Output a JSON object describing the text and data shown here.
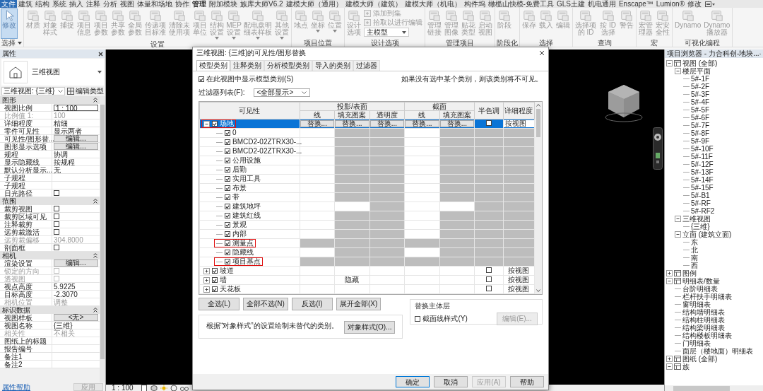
{
  "ribbon": {
    "tabs": [
      {
        "label": "文件",
        "kind": "file",
        "selected": false
      },
      {
        "label": "建筑",
        "kind": "tab",
        "selected": false
      },
      {
        "label": "结构",
        "kind": "tab",
        "selected": false
      },
      {
        "label": "系统",
        "kind": "tab",
        "selected": false
      },
      {
        "label": "插入",
        "kind": "tab",
        "selected": false
      },
      {
        "label": "注释",
        "kind": "tab",
        "selected": false
      },
      {
        "label": "分析",
        "kind": "tab",
        "selected": false
      },
      {
        "label": "视图",
        "kind": "tab",
        "selected": false
      },
      {
        "label": "体量和场地",
        "kind": "tab",
        "selected": false
      },
      {
        "label": "协作",
        "kind": "tab",
        "selected": false
      },
      {
        "label": "管理",
        "kind": "tab",
        "selected": true
      },
      {
        "label": "附加模块",
        "kind": "tab",
        "selected": false
      },
      {
        "label": "族库大师V6.2",
        "kind": "tab",
        "selected": false
      },
      {
        "label": "建模大师（通用）",
        "kind": "tab",
        "selected": false
      },
      {
        "label": "建模大师（建筑）",
        "kind": "tab",
        "selected": false
      },
      {
        "label": "建模大师（机电）",
        "kind": "tab",
        "selected": false
      },
      {
        "label": "构件坞",
        "kind": "tab",
        "selected": false
      },
      {
        "label": "橄榄山快模-免费工具",
        "kind": "tab",
        "selected": false
      },
      {
        "label": "GLS土建",
        "kind": "tab",
        "selected": false
      },
      {
        "label": "机电通用",
        "kind": "tab",
        "selected": false
      },
      {
        "label": "Enscape™",
        "kind": "tab",
        "selected": false
      },
      {
        "label": "Lumion®",
        "kind": "tab",
        "selected": false
      },
      {
        "label": "修改",
        "kind": "tab",
        "selected": false
      }
    ],
    "panels": [
      {
        "title": "选择",
        "menu": true,
        "items": [
          {
            "kind": "large",
            "label": "修改",
            "selected": true,
            "menu": false
          }
        ]
      },
      {
        "title": "设置",
        "menu": false,
        "items": [
          {
            "kind": "large",
            "label": "材质",
            "selected": false,
            "menu": false
          },
          {
            "kind": "large",
            "label": "对象样式",
            "selected": false,
            "menu": false
          },
          {
            "kind": "large",
            "label": "捕捉",
            "selected": false,
            "menu": false
          },
          {
            "kind": "large",
            "label": "项目信息",
            "selected": false,
            "menu": false
          },
          {
            "kind": "large",
            "label": "项目参数",
            "selected": false,
            "menu": false
          },
          {
            "kind": "large",
            "label": "共享参数",
            "selected": false,
            "menu": false
          },
          {
            "kind": "large",
            "label": "全局参数",
            "selected": false,
            "menu": false
          },
          {
            "kind": "large",
            "label": "传递项目标准",
            "selected": false,
            "menu": false
          },
          {
            "kind": "large",
            "label": "清除未使用项",
            "selected": false,
            "menu": false
          },
          {
            "kind": "large",
            "label": "项目单位",
            "selected": false,
            "menu": false
          },
          {
            "kind": "large",
            "label": "结构设置",
            "selected": false,
            "menu": true
          },
          {
            "kind": "large",
            "label": "MEP设置",
            "selected": false,
            "menu": true
          },
          {
            "kind": "large",
            "label": "配电盘明细表样板",
            "selected": false,
            "menu": true
          },
          {
            "kind": "large",
            "label": "其他设置",
            "selected": false,
            "menu": true
          }
        ]
      },
      {
        "title": "项目位置",
        "menu": false,
        "items": [
          {
            "kind": "large",
            "label": "地点",
            "selected": false,
            "menu": false
          },
          {
            "kind": "large",
            "label": "坐标",
            "selected": false,
            "menu": true
          },
          {
            "kind": "large",
            "label": "位置",
            "selected": false,
            "menu": true
          }
        ]
      },
      {
        "title": "设计选项",
        "menu": false,
        "items": [
          {
            "kind": "large",
            "label": "设计选项",
            "selected": false,
            "menu": false
          },
          {
            "kind": "small",
            "label": "添加到集",
            "selected": false,
            "menu": false
          },
          {
            "kind": "small",
            "label": "拾取以进行编辑",
            "selected": false,
            "menu": false
          },
          {
            "kind": "select",
            "label": "主模型",
            "selected": false,
            "menu": true
          }
        ]
      },
      {
        "title": "管理项目",
        "menu": false,
        "items": [
          {
            "kind": "large",
            "label": "管理链接",
            "selected": false,
            "menu": false
          },
          {
            "kind": "large",
            "label": "管理图像",
            "selected": false,
            "menu": false
          },
          {
            "kind": "large",
            "label": "贴花类型",
            "selected": false,
            "menu": false
          },
          {
            "kind": "large",
            "label": "启动视图",
            "selected": false,
            "menu": false
          }
        ]
      },
      {
        "title": "阶段化",
        "menu": false,
        "items": [
          {
            "kind": "large",
            "label": "阶段",
            "selected": false,
            "menu": false
          }
        ]
      },
      {
        "title": "选择",
        "menu": false,
        "items": [
          {
            "kind": "large",
            "label": "保存",
            "selected": false,
            "menu": false
          },
          {
            "kind": "large",
            "label": "载入",
            "selected": false,
            "menu": false
          },
          {
            "kind": "large",
            "label": "编辑",
            "selected": false,
            "menu": false
          }
        ]
      },
      {
        "title": "查询",
        "menu": false,
        "items": [
          {
            "kind": "large",
            "label": "选择项的 ID",
            "selected": false,
            "menu": false
          },
          {
            "kind": "large",
            "label": "按 ID选择",
            "selected": false,
            "menu": false
          },
          {
            "kind": "large",
            "label": "警告",
            "selected": false,
            "menu": false
          }
        ]
      },
      {
        "title": "宏",
        "menu": false,
        "items": [
          {
            "kind": "large",
            "label": "宏管理器",
            "selected": false,
            "menu": false
          },
          {
            "kind": "large",
            "label": "宏安全性",
            "selected": false,
            "menu": false
          }
        ]
      },
      {
        "title": "可视化编程",
        "menu": false,
        "items": [
          {
            "kind": "large",
            "label": "Dynamo",
            "selected": false,
            "menu": false
          },
          {
            "kind": "large",
            "label": "Dynamo播放器",
            "selected": false,
            "menu": false
          }
        ]
      }
    ]
  },
  "properties": {
    "title": "属性",
    "type_name": "三维视图",
    "type_selector": "三维视图: {三维}",
    "edit_type": "编辑类型",
    "groups": [
      {
        "title": "图形",
        "rows": [
          {
            "label": "视图比例",
            "kind": "input",
            "value": "1 : 100",
            "disabled": false
          },
          {
            "label": "比例值 1:",
            "kind": "text",
            "value": "100",
            "disabled": true
          },
          {
            "label": "详细程度",
            "kind": "text",
            "value": "精细",
            "disabled": false
          },
          {
            "label": "零件可见性",
            "kind": "text",
            "value": "显示两者",
            "disabled": false
          },
          {
            "label": "可见性/图形替...",
            "kind": "button",
            "value": "编辑...",
            "disabled": false
          },
          {
            "label": "图形显示选项",
            "kind": "button",
            "value": "编辑...",
            "disabled": false
          },
          {
            "label": "规程",
            "kind": "text",
            "value": "协调",
            "disabled": false
          },
          {
            "label": "显示隐藏线",
            "kind": "text",
            "value": "按规程",
            "disabled": false
          },
          {
            "label": "默认分析显示...",
            "kind": "text",
            "value": "无",
            "disabled": false
          },
          {
            "label": "子规程",
            "kind": "empty",
            "disabled": false
          },
          {
            "label": "子规程",
            "kind": "empty",
            "disabled": false
          },
          {
            "label": "日光路径",
            "kind": "checkbox",
            "checked": false,
            "disabled": false
          }
        ]
      },
      {
        "title": "范围",
        "rows": [
          {
            "label": "裁剪视图",
            "kind": "checkbox",
            "checked": false,
            "disabled": false
          },
          {
            "label": "裁剪区域可见",
            "kind": "checkbox",
            "checked": false,
            "disabled": false
          },
          {
            "label": "注释裁剪",
            "kind": "checkbox",
            "checked": false,
            "disabled": false
          },
          {
            "label": "远剪裁激活",
            "kind": "checkbox",
            "checked": false,
            "disabled": false
          },
          {
            "label": "远剪裁偏移",
            "kind": "text",
            "value": "304.8000",
            "disabled": true
          },
          {
            "label": "剖面框",
            "kind": "checkbox",
            "checked": false,
            "disabled": false
          }
        ]
      },
      {
        "title": "相机",
        "rows": [
          {
            "label": "渲染设置",
            "kind": "button",
            "value": "编辑...",
            "disabled": false
          },
          {
            "label": "锁定的方向",
            "kind": "checkbox",
            "checked": false,
            "disabled": true
          },
          {
            "label": "透视图",
            "kind": "checkbox",
            "checked": false,
            "disabled": true
          },
          {
            "label": "视点高度",
            "kind": "text",
            "value": "5.9225",
            "disabled": false
          },
          {
            "label": "目标高度",
            "kind": "text",
            "value": "-2.3070",
            "disabled": false
          },
          {
            "label": "相机位置",
            "kind": "text",
            "value": "调整",
            "disabled": true
          }
        ]
      },
      {
        "title": "标识数据",
        "rows": [
          {
            "label": "视图样板",
            "kind": "button",
            "value": "<无>",
            "disabled": false
          },
          {
            "label": "视图名称",
            "kind": "text",
            "value": "{三维}",
            "disabled": false
          },
          {
            "label": "相关性",
            "kind": "text",
            "value": "不相关",
            "disabled": true
          },
          {
            "label": "图纸上的标题",
            "kind": "empty",
            "disabled": false
          },
          {
            "label": "报告编号",
            "kind": "empty",
            "disabled": false
          },
          {
            "label": "备注1",
            "kind": "empty",
            "disabled": false
          },
          {
            "label": "备注2",
            "kind": "empty",
            "disabled": false
          }
        ]
      }
    ],
    "help_link": "属性帮助",
    "apply": "应用"
  },
  "status_bar": {
    "scale": "1 : 100"
  },
  "dialog": {
    "title": "三维视图: {三维}的可见性/图形替换",
    "tabs": [
      {
        "label": "模型类别",
        "selected": true
      },
      {
        "label": "注释类别",
        "selected": false
      },
      {
        "label": "分析模型类别",
        "selected": false
      },
      {
        "label": "导入的类别",
        "selected": false
      },
      {
        "label": "过滤器",
        "selected": false
      }
    ],
    "show_categories": {
      "label": "在此视图中显示模型类别(S)",
      "checked": true
    },
    "hint": "如果没有选中某个类别，则该类别将不可见。",
    "filter": {
      "label": "过滤器列表(F):",
      "value": "<全部显示>"
    },
    "table": {
      "visibility": "可见性",
      "projection": "投影/表面",
      "section": "截面",
      "halftone": "半色调",
      "detail": "详细程度",
      "projection_columns": [
        "线",
        "填充图案",
        "透明度"
      ],
      "section_columns": [
        "线",
        "填充图案"
      ],
      "rows": [
        {
          "name": "场地",
          "checked": true,
          "expanded": true,
          "selected": true,
          "marked": true,
          "cells": [
            {
              "kind": "button",
              "text": "替换..."
            },
            {
              "kind": "button",
              "text": "替换..."
            },
            {
              "kind": "button",
              "text": "替换..."
            },
            {
              "kind": "button",
              "text": "替换..."
            },
            {
              "kind": "button",
              "text": "替换..."
            },
            {
              "kind": "checkbox",
              "checked": false
            },
            {
              "kind": "field",
              "text": "按视图"
            }
          ],
          "children": [
            {
              "name": "0",
              "checked": true,
              "selected": false,
              "marked": false,
              "cells": [
                {
                  "kind": "blank"
                },
                {
                  "kind": "na"
                },
                {
                  "kind": "na"
                },
                {
                  "kind": "blank"
                },
                {
                  "kind": "na"
                },
                {
                  "kind": "na"
                },
                {
                  "kind": "na"
                }
              ]
            },
            {
              "name": "BMCD2-02ZTRX30-...",
              "checked": true,
              "selected": false,
              "marked": false,
              "cells": [
                {
                  "kind": "blank"
                },
                {
                  "kind": "na"
                },
                {
                  "kind": "na"
                },
                {
                  "kind": "blank"
                },
                {
                  "kind": "na"
                },
                {
                  "kind": "na"
                },
                {
                  "kind": "na"
                }
              ]
            },
            {
              "name": "BMCD2-02ZTRX30-...",
              "checked": true,
              "selected": false,
              "marked": false,
              "cells": [
                {
                  "kind": "blank"
                },
                {
                  "kind": "na"
                },
                {
                  "kind": "na"
                },
                {
                  "kind": "blank"
                },
                {
                  "kind": "na"
                },
                {
                  "kind": "na"
                },
                {
                  "kind": "na"
                }
              ]
            },
            {
              "name": "公用设施",
              "checked": true,
              "selected": false,
              "marked": false,
              "cells": [
                {
                  "kind": "blank"
                },
                {
                  "kind": "na"
                },
                {
                  "kind": "na"
                },
                {
                  "kind": "blank"
                },
                {
                  "kind": "na"
                },
                {
                  "kind": "na"
                },
                {
                  "kind": "na"
                }
              ]
            },
            {
              "name": "后勤",
              "checked": true,
              "selected": false,
              "marked": false,
              "cells": [
                {
                  "kind": "blank"
                },
                {
                  "kind": "na"
                },
                {
                  "kind": "na"
                },
                {
                  "kind": "blank"
                },
                {
                  "kind": "na"
                },
                {
                  "kind": "na"
                },
                {
                  "kind": "na"
                }
              ]
            },
            {
              "name": "实用工具",
              "checked": true,
              "selected": false,
              "marked": false,
              "cells": [
                {
                  "kind": "blank"
                },
                {
                  "kind": "na"
                },
                {
                  "kind": "na"
                },
                {
                  "kind": "blank"
                },
                {
                  "kind": "na"
                },
                {
                  "kind": "na"
                },
                {
                  "kind": "na"
                }
              ]
            },
            {
              "name": "布景",
              "checked": true,
              "selected": false,
              "marked": false,
              "cells": [
                {
                  "kind": "blank"
                },
                {
                  "kind": "na"
                },
                {
                  "kind": "na"
                },
                {
                  "kind": "blank"
                },
                {
                  "kind": "na"
                },
                {
                  "kind": "na"
                },
                {
                  "kind": "na"
                }
              ]
            },
            {
              "name": "带",
              "checked": true,
              "selected": false,
              "marked": false,
              "cells": [
                {
                  "kind": "blank"
                },
                {
                  "kind": "na"
                },
                {
                  "kind": "na"
                },
                {
                  "kind": "blank"
                },
                {
                  "kind": "na"
                },
                {
                  "kind": "na"
                },
                {
                  "kind": "na"
                }
              ]
            },
            {
              "name": "建筑地坪",
              "checked": true,
              "selected": false,
              "marked": false,
              "cells": [
                {
                  "kind": "blank"
                },
                {
                  "kind": "blank"
                },
                {
                  "kind": "na"
                },
                {
                  "kind": "blank"
                },
                {
                  "kind": "blank"
                },
                {
                  "kind": "na"
                },
                {
                  "kind": "na"
                }
              ]
            },
            {
              "name": "建筑红线",
              "checked": true,
              "selected": false,
              "marked": false,
              "cells": [
                {
                  "kind": "blank"
                },
                {
                  "kind": "na"
                },
                {
                  "kind": "na"
                },
                {
                  "kind": "blank"
                },
                {
                  "kind": "na"
                },
                {
                  "kind": "na"
                },
                {
                  "kind": "na"
                }
              ]
            },
            {
              "name": "景观",
              "checked": true,
              "selected": false,
              "marked": false,
              "cells": [
                {
                  "kind": "blank"
                },
                {
                  "kind": "na"
                },
                {
                  "kind": "na"
                },
                {
                  "kind": "blank"
                },
                {
                  "kind": "na"
                },
                {
                  "kind": "na"
                },
                {
                  "kind": "na"
                }
              ]
            },
            {
              "name": "内部",
              "checked": true,
              "selected": false,
              "marked": false,
              "cells": [
                {
                  "kind": "blank"
                },
                {
                  "kind": "na"
                },
                {
                  "kind": "na"
                },
                {
                  "kind": "blank"
                },
                {
                  "kind": "na"
                },
                {
                  "kind": "na"
                },
                {
                  "kind": "na"
                }
              ]
            },
            {
              "name": "测量点",
              "checked": true,
              "selected": false,
              "marked": true,
              "cells": [
                {
                  "kind": "na"
                },
                {
                  "kind": "na"
                },
                {
                  "kind": "na"
                },
                {
                  "kind": "na"
                },
                {
                  "kind": "na"
                },
                {
                  "kind": "na"
                },
                {
                  "kind": "na"
                }
              ]
            },
            {
              "name": "隐藏线",
              "checked": true,
              "selected": false,
              "marked": false,
              "cells": [
                {
                  "kind": "blank"
                },
                {
                  "kind": "na"
                },
                {
                  "kind": "na"
                },
                {
                  "kind": "blank"
                },
                {
                  "kind": "na"
                },
                {
                  "kind": "na"
                },
                {
                  "kind": "na"
                }
              ]
            },
            {
              "name": "项目基点",
              "checked": true,
              "selected": false,
              "marked": true,
              "cells": [
                {
                  "kind": "na"
                },
                {
                  "kind": "na"
                },
                {
                  "kind": "na"
                },
                {
                  "kind": "na"
                },
                {
                  "kind": "na"
                },
                {
                  "kind": "na"
                },
                {
                  "kind": "na"
                }
              ]
            }
          ]
        },
        {
          "name": "坡道",
          "checked": true,
          "expanded": false,
          "selected": false,
          "marked": false,
          "cells": [
            {
              "kind": "blank"
            },
            {
              "kind": "blank"
            },
            {
              "kind": "blank"
            },
            {
              "kind": "blank"
            },
            {
              "kind": "blank"
            },
            {
              "kind": "checkbox",
              "checked": false
            },
            {
              "kind": "text",
              "text": "按视图"
            }
          ]
        },
        {
          "name": "墙",
          "checked": true,
          "expanded": false,
          "selected": false,
          "marked": false,
          "cells": [
            {
              "kind": "blank"
            },
            {
              "kind": "text",
              "text": "隐藏"
            },
            {
              "kind": "blank"
            },
            {
              "kind": "blank"
            },
            {
              "kind": "blank"
            },
            {
              "kind": "checkbox",
              "checked": false
            },
            {
              "kind": "text",
              "text": "按视图"
            }
          ]
        },
        {
          "name": "天花板",
          "checked": true,
          "expanded": false,
          "selected": false,
          "marked": false,
          "cells": [
            {
              "kind": "blank"
            },
            {
              "kind": "blank"
            },
            {
              "kind": "blank"
            },
            {
              "kind": "blank"
            },
            {
              "kind": "blank"
            },
            {
              "kind": "checkbox",
              "checked": false
            },
            {
              "kind": "text",
              "text": "按视图"
            }
          ]
        }
      ]
    },
    "select_buttons": [
      "全选(L)",
      "全部不选(N)",
      "反选(I)",
      "展开全部(X)"
    ],
    "host_layers": {
      "title": "替换主体层",
      "label": "截面线样式(Y)",
      "checked": false,
      "edit": "编辑(E)...",
      "edit_disabled": true
    },
    "note": "根据“对象样式”的设置绘制未替代的类别。",
    "object_styles": "对象样式(O)...",
    "footer": [
      {
        "label": "确定",
        "default": true,
        "disabled": false
      },
      {
        "label": "取消",
        "default": false,
        "disabled": false
      },
      {
        "label": "应用(A)",
        "default": false,
        "disabled": true
      },
      {
        "label": "帮助",
        "default": false,
        "disabled": false
      }
    ]
  },
  "browser": {
    "title": "项目浏览器 - 力合科创-地块...",
    "tree": [
      {
        "label": "视图 (全部)",
        "expanded": true,
        "children": [
          {
            "label": "楼层平面",
            "expanded": true,
            "children": [
              {
                "label": "5#-1F"
              },
              {
                "label": "5#-2F"
              },
              {
                "label": "5#-3F"
              },
              {
                "label": "5#-4F"
              },
              {
                "label": "5#-5F"
              },
              {
                "label": "5#-6F"
              },
              {
                "label": "5#-7F"
              },
              {
                "label": "5#-8F"
              },
              {
                "label": "5#-9F"
              },
              {
                "label": "5#-10F"
              },
              {
                "label": "5#-11F"
              },
              {
                "label": "5#-12F"
              },
              {
                "label": "5#-13F"
              },
              {
                "label": "5#-14F"
              },
              {
                "label": "5#-15F"
              },
              {
                "label": "5#-B1"
              },
              {
                "label": "5#-RF"
              },
              {
                "label": "5#-RF2"
              }
            ]
          },
          {
            "label": "三维视图",
            "expanded": true,
            "children": [
              {
                "label": "{三维}"
              }
            ]
          },
          {
            "label": "立面 (建筑立面)",
            "expanded": true,
            "children": [
              {
                "label": "东"
              },
              {
                "label": "北"
              },
              {
                "label": "南"
              },
              {
                "label": "西"
              }
            ]
          }
        ]
      },
      {
        "label": "图例",
        "expanded": false
      },
      {
        "label": "明细表/数量",
        "expanded": true,
        "children": [
          {
            "label": "台阶明细表"
          },
          {
            "label": "栏杆扶手明细表"
          },
          {
            "label": "窗明细表"
          },
          {
            "label": "结构墙明细表"
          },
          {
            "label": "结构柱明细表"
          },
          {
            "label": "结构梁明细表"
          },
          {
            "label": "结构楼板明细表"
          },
          {
            "label": "门明细表"
          },
          {
            "label": "面层（楼地面）明细表"
          }
        ]
      },
      {
        "label": "图纸 (全部)",
        "expanded": false
      },
      {
        "label": "族",
        "expanded": true
      }
    ]
  }
}
